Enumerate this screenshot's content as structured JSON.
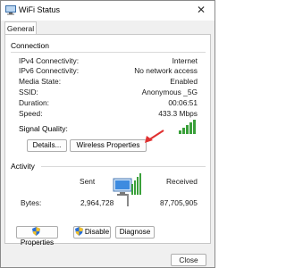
{
  "window": {
    "title": "WiFi Status"
  },
  "tabs": [
    {
      "label": "General"
    }
  ],
  "connection": {
    "heading": "Connection",
    "rows": [
      {
        "label": "IPv4 Connectivity:",
        "value": "Internet"
      },
      {
        "label": "IPv6 Connectivity:",
        "value": "No network access"
      },
      {
        "label": "Media State:",
        "value": "Enabled"
      },
      {
        "label": "SSID:",
        "value": "Anonymous _5G"
      },
      {
        "label": "Duration:",
        "value": "00:06:51"
      },
      {
        "label": "Speed:",
        "value": "433.3 Mbps"
      }
    ],
    "signal_label": "Signal Quality:",
    "signal_bars": 5,
    "buttons": {
      "details": "Details...",
      "wireless_properties": "Wireless Properties"
    }
  },
  "activity": {
    "heading": "Activity",
    "sent_label": "Sent",
    "received_label": "Received",
    "bytes_label": "Bytes:",
    "bytes_sent": "2,964,728",
    "bytes_received": "87,705,905",
    "buttons": {
      "properties": "Properties",
      "disable": "Disable",
      "diagnose": "Diagnose"
    }
  },
  "footer": {
    "close": "Close"
  },
  "colors": {
    "signal": "#3aa03a",
    "arrow": "#e03030",
    "shield_blue": "#2a6fd6",
    "shield_yellow": "#f3c12a"
  }
}
